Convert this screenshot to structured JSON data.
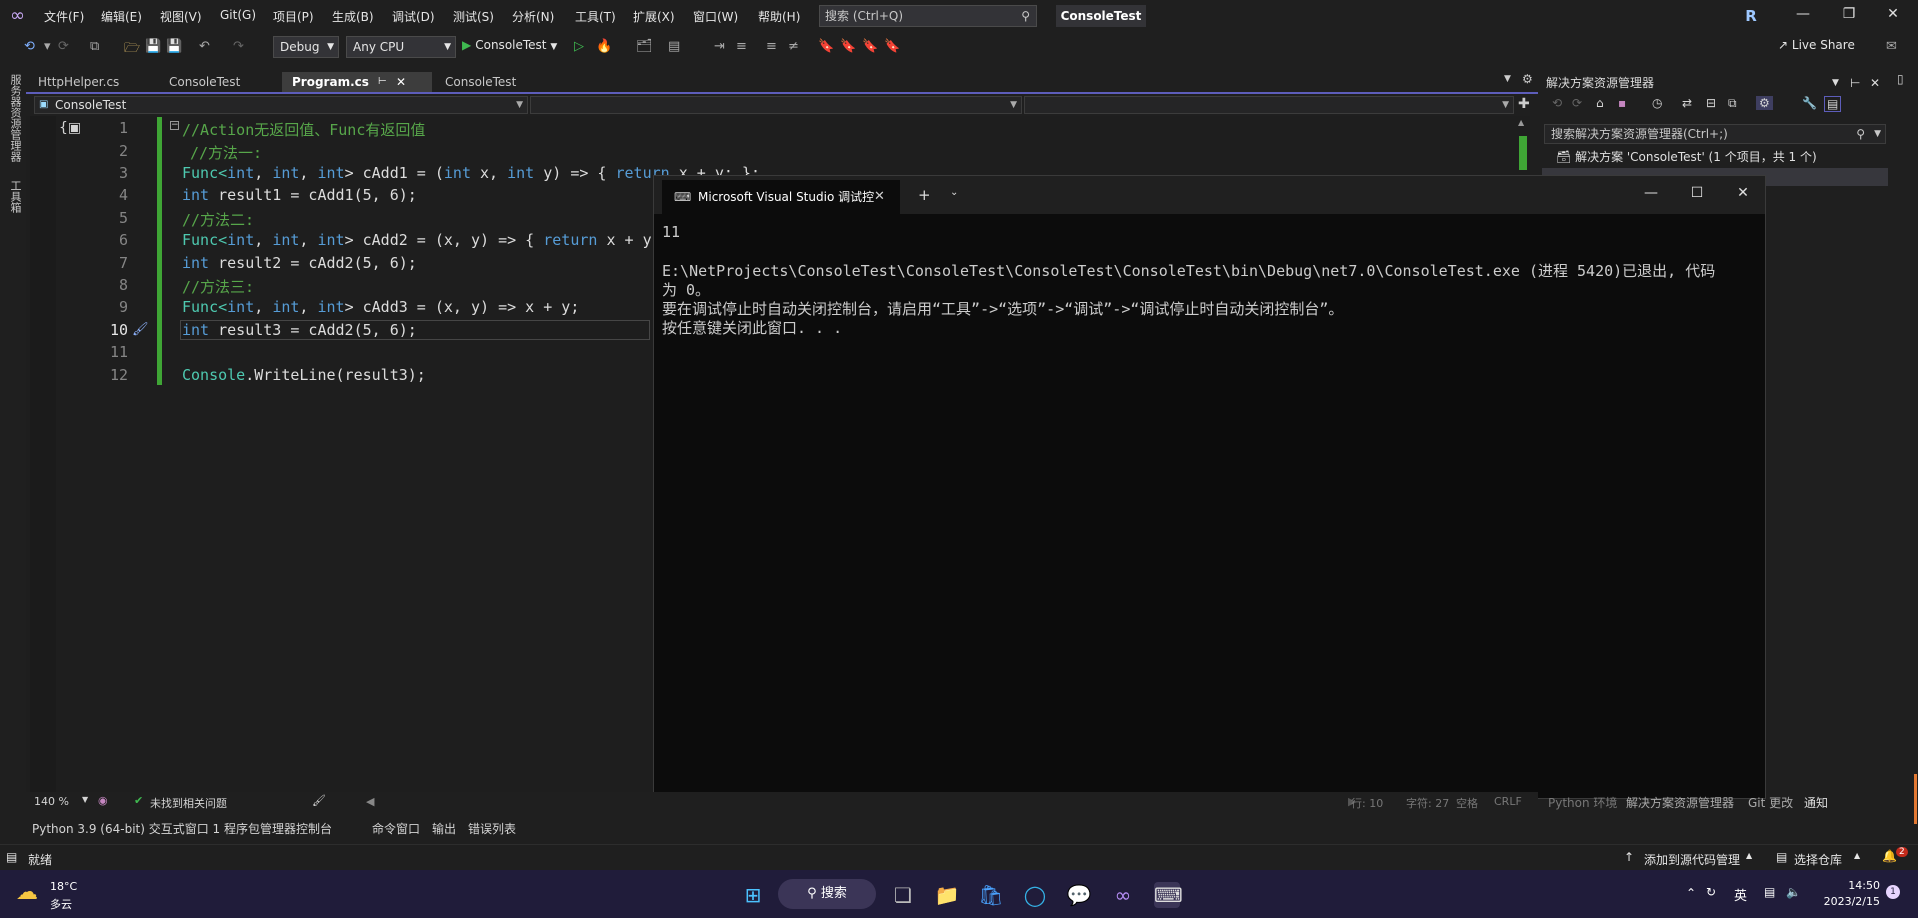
{
  "titlebar": {
    "menu": [
      "文件(F)",
      "编辑(E)",
      "视图(V)",
      "Git(G)",
      "项目(P)",
      "生成(B)",
      "调试(D)",
      "测试(S)",
      "分析(N)",
      "工具(T)",
      "扩展(X)",
      "窗口(W)",
      "帮助(H)"
    ],
    "search_placeholder": "搜索 (Ctrl+Q)",
    "solution_name": "ConsoleTest",
    "user_initial": "R"
  },
  "toolbar": {
    "configuration": "Debug",
    "platform": "Any CPU",
    "run_target": "ConsoleTest",
    "live_share": "Live Share"
  },
  "left_strip": {
    "server_explorer": "服务器资源管理器",
    "toolbox": "工具箱"
  },
  "doc_tabs": [
    {
      "label": "HttpHelper.cs"
    },
    {
      "label": "ConsoleTest"
    },
    {
      "label": "Program.cs"
    },
    {
      "label": "ConsoleTest"
    }
  ],
  "navbar": {
    "project": "ConsoleTest"
  },
  "editor": {
    "line_numbers": [
      "1",
      "2",
      "3",
      "4",
      "5",
      "6",
      "7",
      "8",
      "9",
      "10",
      "11",
      "12"
    ],
    "current_line": "10",
    "code": {
      "l1": "//Action无返回值、Func有返回值",
      "l2": "//方法一:",
      "l3a": "Func<",
      "l3b": "int",
      "l3c": ", ",
      "l3d": "int",
      "l3e": ", ",
      "l3f": "int",
      "l3g": "> cAdd1 = (",
      "l3h": "int",
      "l3i": " x, ",
      "l3j": "int",
      "l3k": " y) => { ",
      "l3l": "return",
      "l3m": " x + y; };",
      "l4a": "int",
      "l4b": " result1 = cAdd1(5, 6);",
      "l5": "//方法二:",
      "l6a": "Func<",
      "l6b": "int",
      "l6c": ", ",
      "l6d": "int",
      "l6e": ", ",
      "l6f": "int",
      "l6g": "> cAdd2 = (x, y) => { ",
      "l6h": "return",
      "l6i": " x + y",
      "l7a": "int",
      "l7b": " result2 = cAdd2(5, 6);",
      "l8": "//方法三:",
      "l9a": "Func<",
      "l9b": "int",
      "l9c": ", ",
      "l9d": "int",
      "l9e": ", ",
      "l9f": "int",
      "l9g": "> cAdd3 = (x, y) => x + y;",
      "l10a": "int",
      "l10b": " result3 = cAdd2(5, 6);",
      "l12a": "Console",
      "l12b": ".WriteLine(result3);"
    }
  },
  "console": {
    "tab_title": "Microsoft Visual Studio 调试控",
    "lines": [
      "11",
      "",
      "E:\\NetProjects\\ConsoleTest\\ConsoleTest\\ConsoleTest\\ConsoleTest\\bin\\Debug\\net7.0\\ConsoleTest.exe (进程 5420)已退出, 代码",
      "为 0。",
      "要在调试停止时自动关闭控制台，请启用“工具”->“选项”->“调试”->“调试停止时自动关闭控制台”。",
      "按任意键关闭此窗口. . ."
    ]
  },
  "solution_explorer": {
    "title": "解决方案资源管理器",
    "search_placeholder": "搜索解决方案资源管理器(Ctrl+;)",
    "solution_label": "解决方案 'ConsoleTest' (1 个项目，共 1 个)"
  },
  "editor_status": {
    "zoom": "140 %",
    "issues": "未找到相关问题",
    "line": "行: 10",
    "column": "字符: 27",
    "whitespace": "空格",
    "line_ending": "CRLF"
  },
  "tool_tabs": {
    "left": [
      "Python 3.9 (64-bit) 交互式窗口 1",
      "程序包管理器控制台",
      "命令窗口",
      "输出",
      "错误列表"
    ],
    "right": [
      "Python 环境",
      "解决方案资源管理器",
      "Git 更改",
      "通知"
    ]
  },
  "statusbar": {
    "ready": "就绪",
    "add_source_control": "添加到源代码管理",
    "select_repo": "选择仓库",
    "notification_count": "2"
  },
  "taskbar": {
    "weather_temp": "18°C",
    "weather_desc": "多云",
    "search_label": "搜索",
    "ime": "英",
    "time": "14:50",
    "date": "2023/2/15",
    "notification_badge": "1"
  },
  "colors": {
    "accent": "#5d5dba",
    "change_bar": "#3fa535",
    "keyword": "#569cd6",
    "comment": "#57a64a"
  }
}
